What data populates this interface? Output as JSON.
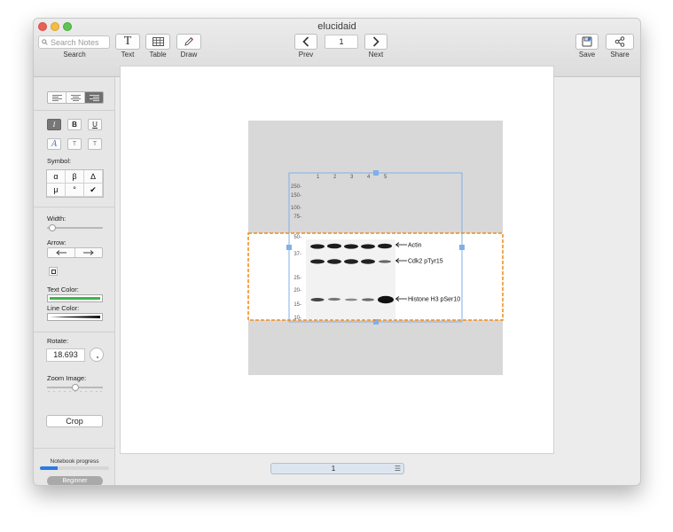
{
  "window": {
    "title": "elucidaid"
  },
  "toolbar": {
    "search_placeholder": "Search Notes",
    "search_label": "Search",
    "text_label": "Text",
    "table_label": "Table",
    "draw_label": "Draw",
    "prev_label": "Prev",
    "page_number": "1",
    "next_label": "Next",
    "save_label": "Save",
    "share_label": "Share"
  },
  "sidebar": {
    "align_buttons": [
      "align-left",
      "align-center",
      "align-right"
    ],
    "style_buttons": {
      "italic": "I",
      "bold": "B",
      "underline": "U",
      "font": "A",
      "superscript": "T",
      "subscript": "T"
    },
    "symbol_label": "Symbol:",
    "symbols": [
      "α",
      "β",
      "∆",
      "μ",
      "°",
      "✔"
    ],
    "width_label": "Width:",
    "width_value": 0.05,
    "arrow_label": "Arrow:",
    "text_color_label": "Text Color:",
    "text_color": "#3cb54a",
    "line_color_label": "Line Color:",
    "line_color": "#111111",
    "rotate_label": "Rotate:",
    "rotate_value": "18.693",
    "zoom_label": "Zoom Image:",
    "zoom_value": 0.5,
    "crop_label": "Crop",
    "progress_label": "Notebook progress",
    "progress_value": 0.25,
    "level_label": "Beginner"
  },
  "blot": {
    "lanes": [
      "1",
      "2",
      "3",
      "4",
      "5"
    ],
    "markers": [
      "250-",
      "150-",
      "100-",
      "75-",
      "50-",
      "37-",
      "25-",
      "20-",
      "15-",
      "10-"
    ],
    "bands": [
      "Actin",
      "Cdk2 pTyr15",
      "Histone H3 pSer10"
    ]
  },
  "bottom_bar": {
    "page_number": "1"
  },
  "colors": {
    "crop_border": "#f08a1c",
    "selection": "#7fb0e8",
    "accent": "#2a7be4"
  }
}
